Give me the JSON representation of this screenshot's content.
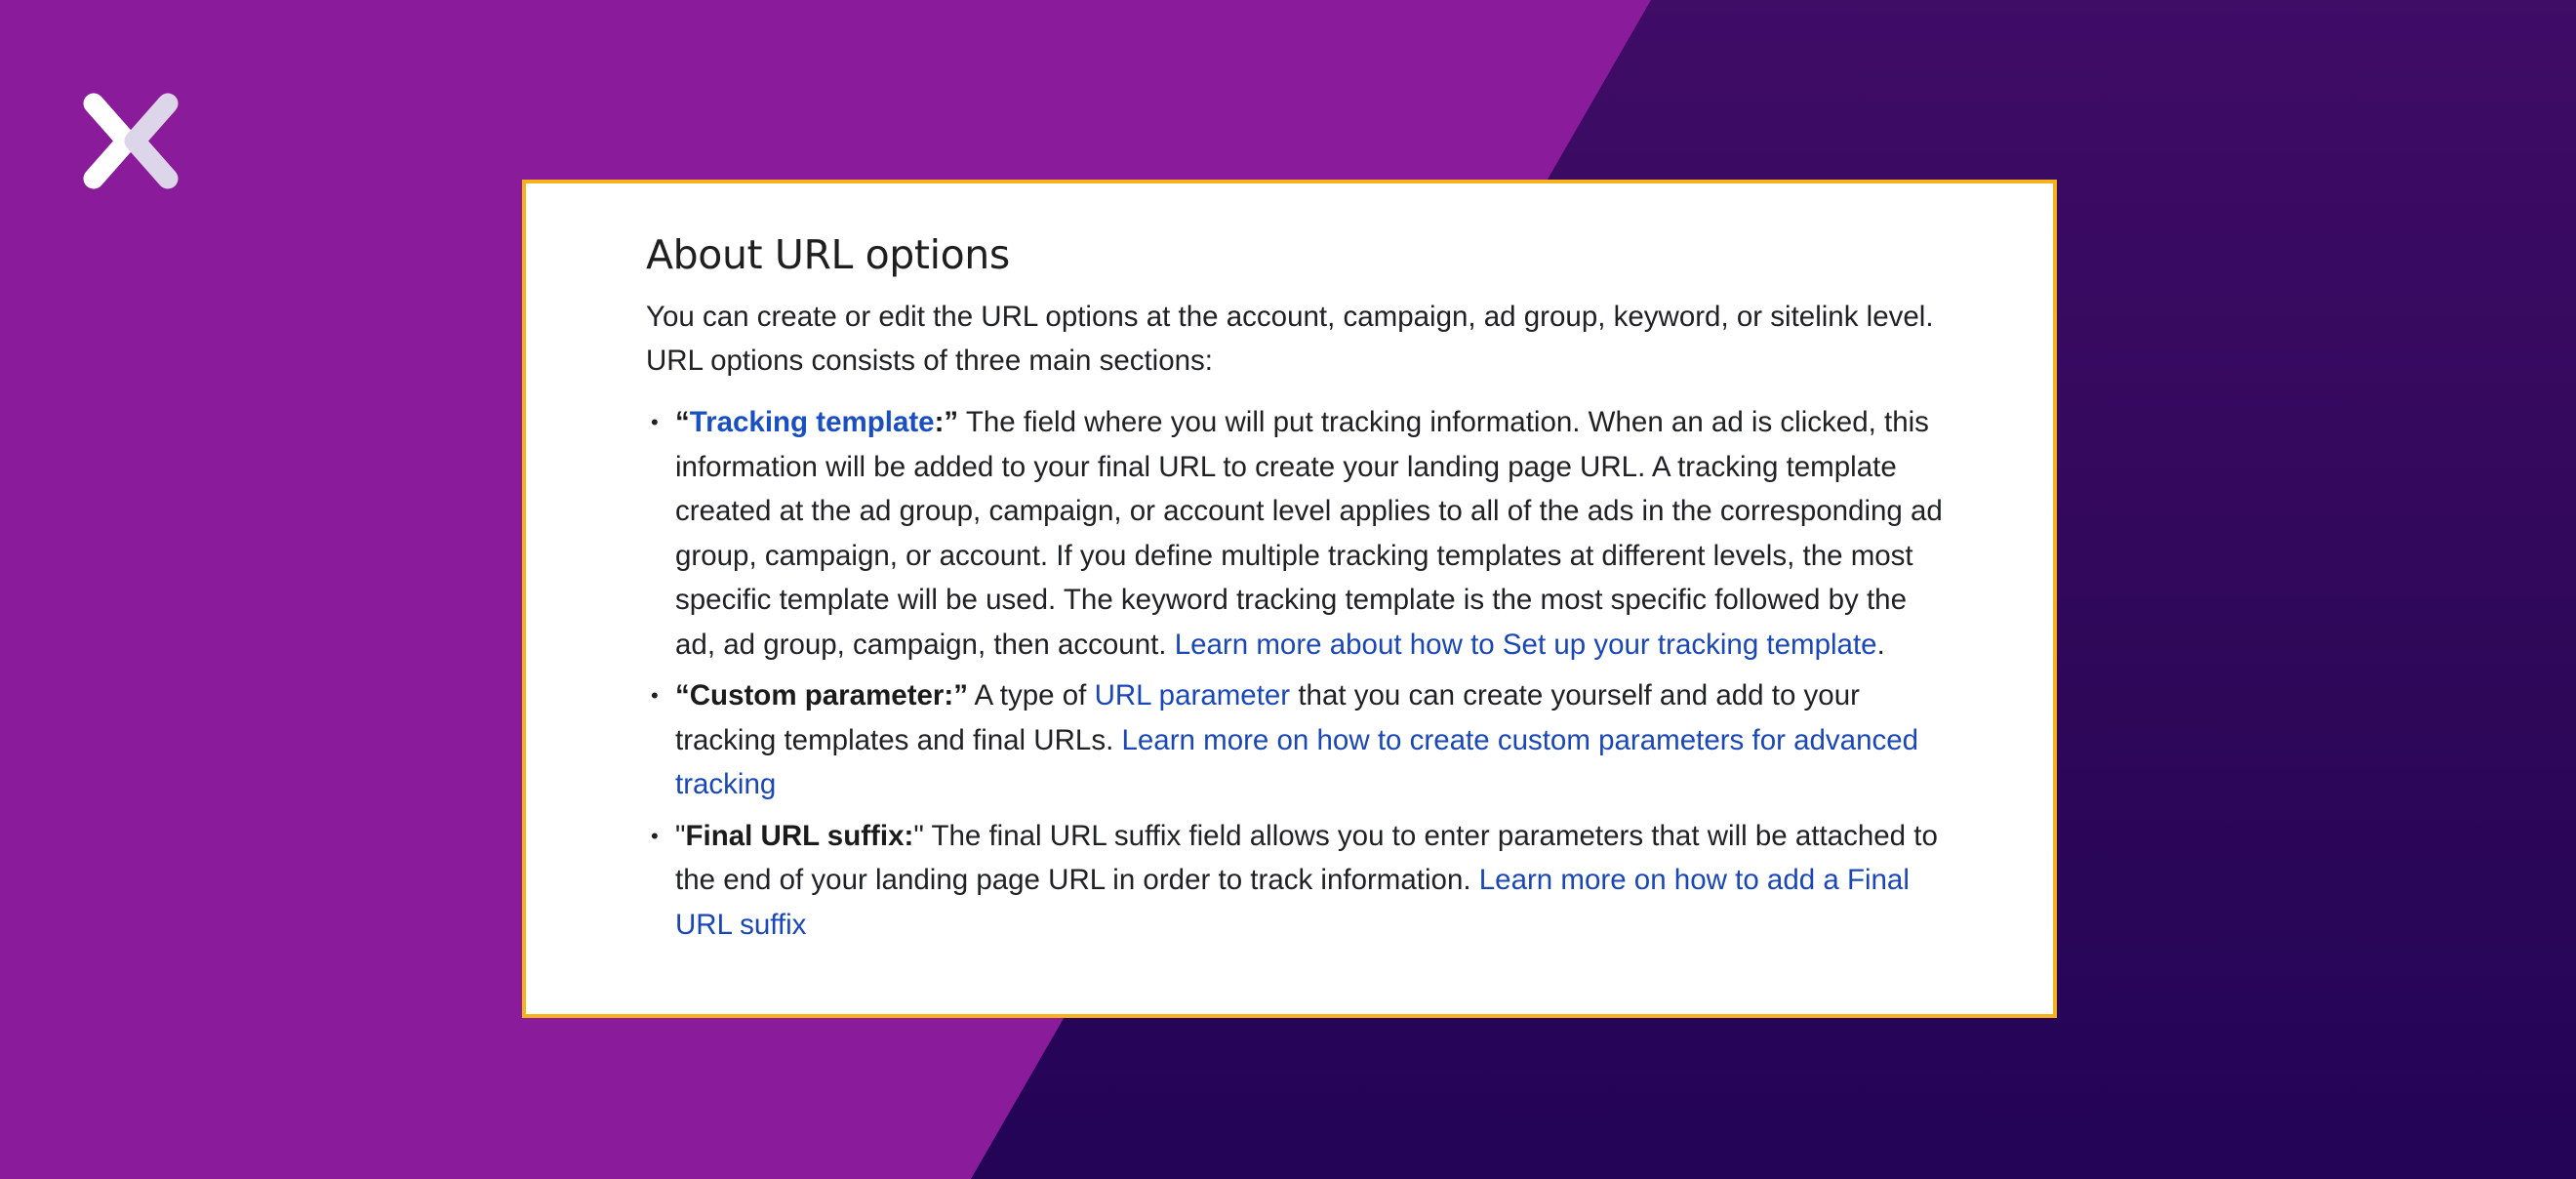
{
  "colors": {
    "background_left": "#8a1b9a",
    "background_right_top": "#3f0c66",
    "background_right_bottom": "#230457",
    "card_border": "#f6b21b",
    "link": "#1a47b8",
    "text": "#202124"
  },
  "logo": {
    "icon": "x-logo-icon"
  },
  "card": {
    "title": "About URL options",
    "intro": "You can create or edit the URL options at the account, campaign, ad group, keyword, or sitelink level. URL options consists of three main sections:",
    "items": [
      {
        "open_quote": "“",
        "term_link": "Tracking template",
        "term_suffix": ":”",
        "text": " The field where you will put tracking information. When an ad is clicked, this information will be added to your final URL to create your landing page URL. A tracking template created at the ad group, campaign, or account level applies to all of the ads in the corresponding ad group, campaign, or account. If you define multiple tracking templates at different levels, the most specific template will be used. The keyword tracking template is the most specific followed by the ad, ad group, campaign, then account. ",
        "link": "Learn more about how to Set up your tracking template",
        "trailing": "."
      },
      {
        "term": "“Custom parameter:”",
        "text_before": " A type of ",
        "inline_link": "URL parameter",
        "text_after": " that you can create yourself and add to your tracking templates and final URLs. ",
        "link": "Learn more on how to create custom parameters for advanced tracking"
      },
      {
        "open_quote": "\"",
        "term": "Final URL suffix:",
        "close_quote": "\"",
        "text": " The final URL suffix field allows you to enter parameters that will be attached to the end of your landing page URL in order to track information. ",
        "link": "Learn more on how to add a Final URL suffix"
      }
    ]
  }
}
